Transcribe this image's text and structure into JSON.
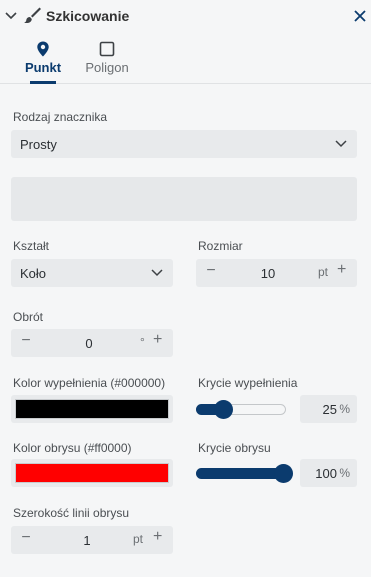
{
  "header": {
    "title": "Szkicowanie"
  },
  "tabs": [
    {
      "label": "Punkt",
      "icon": "map-pin-icon",
      "active": true
    },
    {
      "label": "Poligon",
      "icon": "square-outline-icon",
      "active": false
    }
  ],
  "marker_type": {
    "label": "Rodzaj znacznika",
    "value": "Prosty"
  },
  "shape": {
    "label": "Kształt",
    "value": "Koło"
  },
  "size": {
    "label": "Rozmiar",
    "value": "10",
    "unit": "pt"
  },
  "rotation": {
    "label": "Obrót",
    "value": "0",
    "unit": "°"
  },
  "fill_color": {
    "label": "Kolor wypełnienia (#000000)",
    "color": "#000000"
  },
  "fill_opacity": {
    "label": "Krycie wypełnienia",
    "value": "25",
    "unit": "%",
    "level": 0.25
  },
  "stroke_color": {
    "label": "Kolor obrysu (#ff0000)",
    "color": "#ff0000"
  },
  "stroke_opacity": {
    "label": "Krycie obrysu",
    "value": "100",
    "unit": "%",
    "level": 1.0
  },
  "stroke_width": {
    "label": "Szerokość linii obrysu",
    "value": "1",
    "unit": "pt"
  },
  "colors": {
    "accent": "#0b3b6e",
    "panel": "#f5f6f7",
    "field": "#e8eaec"
  }
}
